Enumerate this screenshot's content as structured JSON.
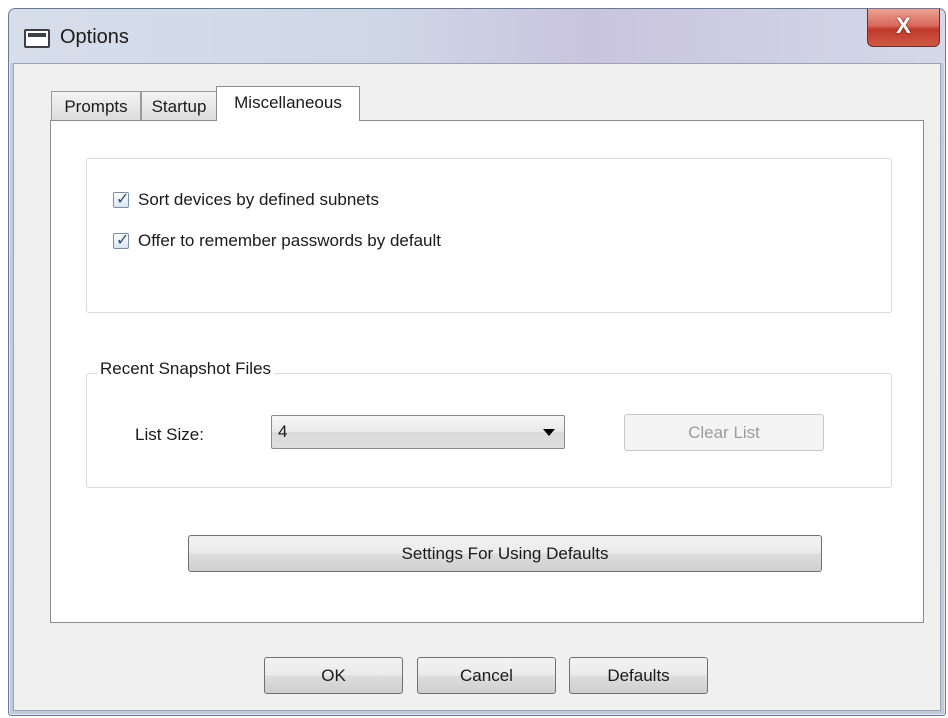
{
  "window": {
    "title": "Options",
    "icon": "window-icon",
    "close_label": "X"
  },
  "tabs": [
    {
      "label": "Prompts",
      "selected": false
    },
    {
      "label": "Startup",
      "selected": false
    },
    {
      "label": "Miscellaneous",
      "selected": true
    }
  ],
  "misc": {
    "checkboxes": [
      {
        "label": "Sort devices by defined subnets",
        "checked": true
      },
      {
        "label": "Offer to remember passwords by default",
        "checked": true
      }
    ],
    "snapshot_group": {
      "legend": "Recent Snapshot Files",
      "list_size_label": "List Size:",
      "list_size_value": "4",
      "clear_list_label": "Clear List",
      "clear_list_enabled": false
    },
    "settings_defaults_label": "Settings For Using Defaults"
  },
  "footer": {
    "ok_label": "OK",
    "cancel_label": "Cancel",
    "defaults_label": "Defaults"
  },
  "check_glyph": "✓",
  "colors": {
    "close_button": "#c0392b",
    "checkmark": "#2f4a76"
  }
}
